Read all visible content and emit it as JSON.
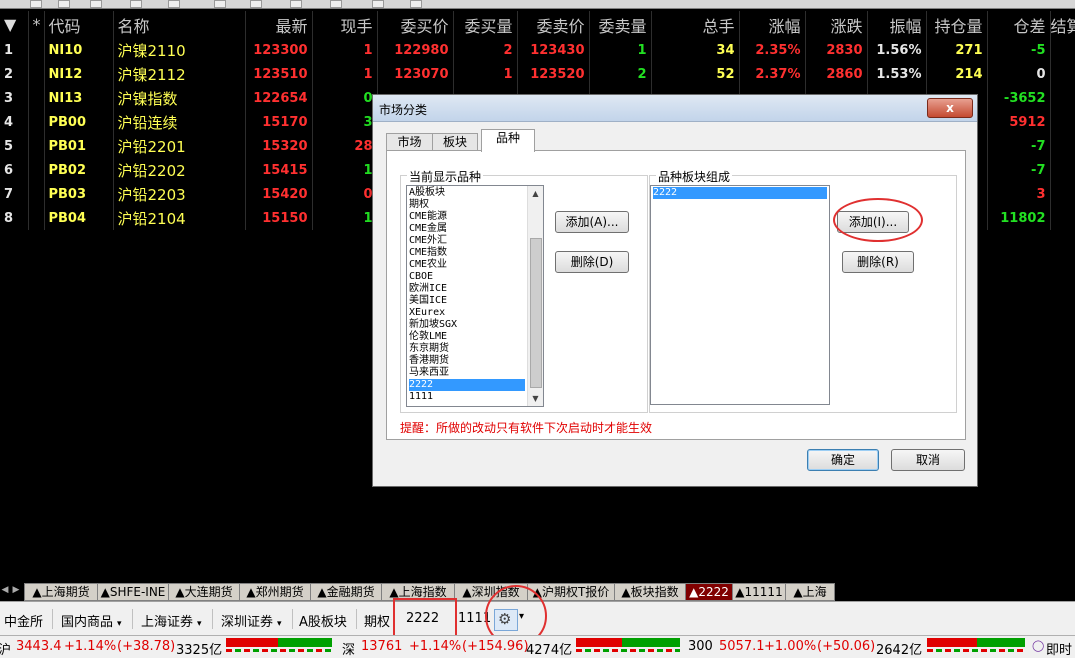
{
  "table": {
    "columns": [
      "*",
      "代码",
      "名称",
      "最新",
      "现手",
      "委买价",
      "委买量",
      "委卖价",
      "委卖量",
      "总手",
      "涨幅",
      "涨跌",
      "振幅",
      "持仓量",
      "仓差",
      "结算价"
    ],
    "rows": [
      {
        "idx": "1",
        "code": "NI10",
        "name": "沪镍2110",
        "last": "123300",
        "cur": "1",
        "bid": "122980",
        "bidv": "2",
        "ask": "123430",
        "askv": "1",
        "vol": "34",
        "pct": "2.35%",
        "chg": "2830",
        "amp": "1.56%",
        "oi": "271",
        "oid": "-5",
        "settle": ""
      },
      {
        "idx": "2",
        "code": "NI12",
        "name": "沪镍2112",
        "last": "123510",
        "cur": "1",
        "bid": "123070",
        "bidv": "1",
        "ask": "123520",
        "askv": "2",
        "vol": "52",
        "pct": "2.37%",
        "chg": "2860",
        "amp": "1.53%",
        "oi": "214",
        "oid": "0",
        "settle": ""
      },
      {
        "idx": "3",
        "code": "NI13",
        "name": "沪镍指数",
        "last": "122654",
        "cur": "0",
        "bid": "",
        "bidv": "",
        "ask": "",
        "askv": "",
        "vol": "",
        "pct": "",
        "chg": "",
        "amp": "",
        "oi": "",
        "oid": "-3652",
        "settle": ""
      },
      {
        "idx": "4",
        "code": "PB00",
        "name": "沪铅连续",
        "last": "15170",
        "cur": "3",
        "bid": "",
        "bidv": "",
        "ask": "",
        "askv": "",
        "vol": "",
        "pct": "",
        "chg": "",
        "amp": "",
        "oi": "",
        "oid": "5912",
        "settle": ""
      },
      {
        "idx": "5",
        "code": "PB01",
        "name": "沪铅2201",
        "last": "15320",
        "cur": "28",
        "bid": "",
        "bidv": "",
        "ask": "",
        "askv": "",
        "vol": "",
        "pct": "",
        "chg": "",
        "amp": "",
        "oi": "",
        "oid": "-7",
        "settle": ""
      },
      {
        "idx": "6",
        "code": "PB02",
        "name": "沪铅2202",
        "last": "15415",
        "cur": "1",
        "bid": "",
        "bidv": "",
        "ask": "",
        "askv": "",
        "vol": "",
        "pct": "",
        "chg": "",
        "amp": "",
        "oi": "",
        "oid": "-7",
        "settle": ""
      },
      {
        "idx": "7",
        "code": "PB03",
        "name": "沪铅2203",
        "last": "15420",
        "cur": "0",
        "bid": "",
        "bidv": "",
        "ask": "",
        "askv": "",
        "vol": "",
        "pct": "",
        "chg": "",
        "amp": "",
        "oi": "",
        "oid": "3",
        "settle": ""
      },
      {
        "idx": "8",
        "code": "PB04",
        "name": "沪铅2104",
        "last": "15150",
        "cur": "1",
        "bid": "",
        "bidv": "",
        "ask": "",
        "askv": "",
        "vol": "",
        "pct": "",
        "chg": "",
        "amp": "",
        "oi": "",
        "oid": "11802",
        "settle": ""
      }
    ]
  },
  "dialog": {
    "title": "市场分类",
    "close": "x",
    "tabs": [
      "市场",
      "板块",
      "品种"
    ],
    "left_group": "当前显示品种",
    "left_items": [
      "A股板块",
      "期权",
      "CME能源",
      "CME金属",
      "CME外汇",
      "CME指数",
      "CME农业",
      "CBOE",
      "欧洲ICE",
      "美国ICE",
      "XEurex",
      "新加坡SGX",
      "伦敦LME",
      "东京期货",
      "香港期货",
      "马来西亚",
      "2222",
      "1111"
    ],
    "left_selected": "2222",
    "add_left": "添加(A)...",
    "del_left": "删除(D)",
    "right_group": "品种板块组成",
    "right_items": [
      "2222"
    ],
    "add_right": "添加(I)...",
    "del_right": "删除(R)",
    "hint": "提醒：所做的改动只有软件下次启动时才能生效",
    "ok": "确定",
    "cancel": "取消"
  },
  "sheet_tabs": [
    "▲上海期货",
    "▲SHFE-INE",
    "▲大连期货",
    "▲郑州期货",
    "▲金融期货",
    "▲上海指数",
    "▲深圳指数",
    "▲沪期权T报价",
    "▲板块指数",
    "▲2222",
    "▲11111",
    "▲上海"
  ],
  "sheet_active": "▲2222",
  "categories": {
    "items": [
      "中金所",
      "国内商品",
      "上海证券",
      "深圳证券",
      "A股板块",
      "期权",
      "2222",
      "1111"
    ],
    "dropdown_marks": [
      "▾",
      "▾",
      "▾",
      "▾"
    ]
  },
  "status": {
    "sh_label": "沪",
    "sh_val": "3443.4",
    "sh_pct": "+1.14%",
    "sh_chg": "(+38.78)",
    "sh_amt": "3325亿",
    "sz_label": "深",
    "sz_val": "13761",
    "sz_pct": "+1.14%",
    "sz_chg": "(+154.96)",
    "sz_amt": "4274亿",
    "i300_label": "300",
    "i300_val": "5057.1",
    "i300_pct": "+1.00%",
    "i300_chg": "(+50.06)",
    "i300_amt": "2642亿",
    "right_label": "即时"
  },
  "colors": {
    "up": "#ff3030",
    "down": "#22e022",
    "code": "#ffff54",
    "active_tab": "#800000",
    "selection": "#3399ff",
    "annotation": "#e03030"
  }
}
